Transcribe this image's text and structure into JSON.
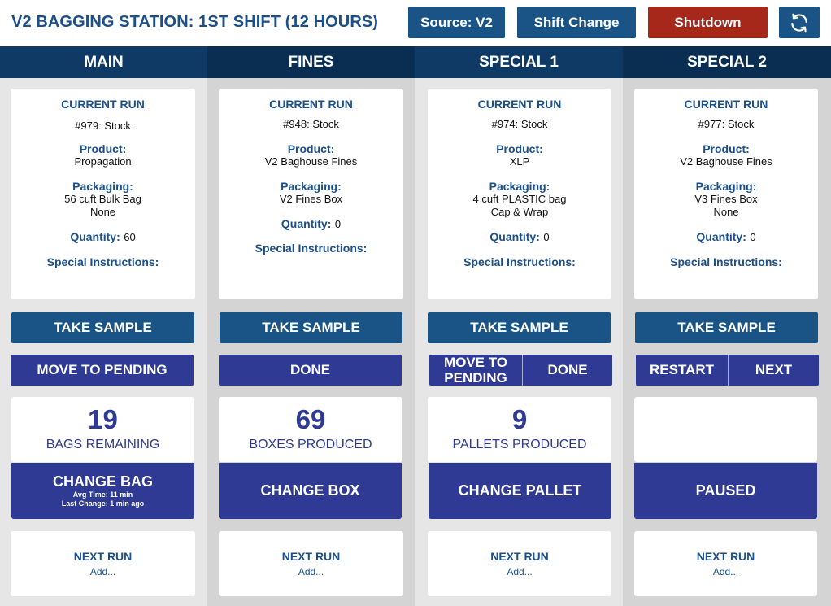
{
  "header": {
    "title": "V2 BAGGING STATION: 1ST SHIFT (12 HOURS)",
    "source_label": "Source: V2",
    "shift_change_label": "Shift Change",
    "shutdown_label": "Shutdown",
    "refresh_icon": "refresh-icon"
  },
  "colors": {
    "header_blue": "#1a5487",
    "header_dark": "#0f3a66",
    "action_indigo": "#2e3a94",
    "shutdown_red": "#a6281a"
  },
  "columns": [
    {
      "name": "MAIN",
      "current_run_label": "CURRENT RUN",
      "run": "#979: Stock",
      "product_label": "Product:",
      "product": "Propagation",
      "packaging_label": "Packaging:",
      "packaging": [
        "56 cuft Bulk Bag",
        "None"
      ],
      "quantity_label": "Quantity:",
      "quantity": "60",
      "special_label": "Special Instructions:",
      "sample_label": "TAKE SAMPLE",
      "actions": [
        "MOVE TO PENDING"
      ],
      "count": "19",
      "count_label": "BAGS REMAINING",
      "change_label": "CHANGE BAG",
      "change_sub": [
        "Avg Time: 11 min",
        "Last Change: 1 min ago"
      ],
      "next_label": "NEXT RUN",
      "next_add": "Add..."
    },
    {
      "name": "FINES",
      "current_run_label": "CURRENT RUN",
      "run": "#948: Stock",
      "product_label": "Product:",
      "product": "V2 Baghouse Fines",
      "packaging_label": "Packaging:",
      "packaging": [
        "V2 Fines Box"
      ],
      "quantity_label": "Quantity:",
      "quantity": "0",
      "special_label": "Special Instructions:",
      "sample_label": "TAKE SAMPLE",
      "actions": [
        "DONE"
      ],
      "count": "69",
      "count_label": "BOXES PRODUCED",
      "change_label": "CHANGE BOX",
      "next_label": "NEXT RUN",
      "next_add": "Add..."
    },
    {
      "name": "SPECIAL 1",
      "current_run_label": "CURRENT RUN",
      "run": "#974: Stock",
      "product_label": "Product:",
      "product": "XLP",
      "packaging_label": "Packaging:",
      "packaging": [
        "4 cuft PLASTIC bag",
        "Cap & Wrap"
      ],
      "quantity_label": "Quantity:",
      "quantity": "0",
      "special_label": "Special Instructions:",
      "sample_label": "TAKE SAMPLE",
      "actions": [
        "MOVE TO PENDING",
        "DONE"
      ],
      "count": "9",
      "count_label": "PALLETS PRODUCED",
      "change_label": "CHANGE PALLET",
      "next_label": "NEXT RUN",
      "next_add": "Add..."
    },
    {
      "name": "SPECIAL 2",
      "current_run_label": "CURRENT RUN",
      "run": "#977: Stock",
      "product_label": "Product:",
      "product": "V2 Baghouse Fines",
      "packaging_label": "Packaging:",
      "packaging": [
        "V3 Fines Box",
        "None"
      ],
      "quantity_label": "Quantity:",
      "quantity": "0",
      "special_label": "Special Instructions:",
      "sample_label": "TAKE SAMPLE",
      "actions": [
        "RESTART",
        "NEXT"
      ],
      "count": "",
      "count_label": "",
      "change_label": "PAUSED",
      "next_label": "NEXT RUN",
      "next_add": "Add..."
    }
  ]
}
